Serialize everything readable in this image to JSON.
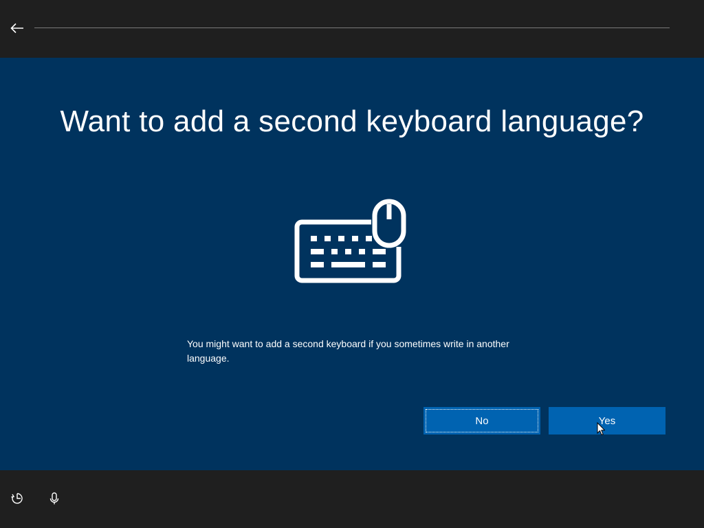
{
  "header": {
    "back_icon": "arrow-left-icon"
  },
  "main": {
    "title": "Want to add a second keyboard language?",
    "illustration_icon": "keyboard-mouse-icon",
    "description": "You might want to add a second keyboard if you sometimes write in another language.",
    "buttons": {
      "no_label": "No",
      "yes_label": "Yes"
    }
  },
  "footer": {
    "icons": [
      "ease-of-access-icon",
      "microphone-icon"
    ]
  },
  "colors": {
    "main_background": "#00335e",
    "bar_background": "#1f1f1f",
    "button_background": "#0063b1",
    "text": "#ffffff"
  }
}
